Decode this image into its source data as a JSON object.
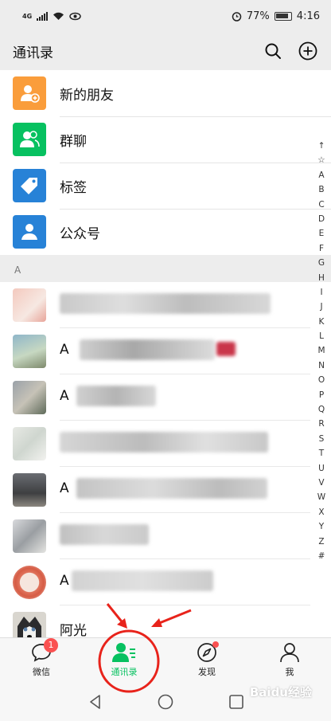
{
  "status_bar": {
    "network": "4G",
    "alarm_icon": "alarm-clock-icon",
    "battery_percent": "77%",
    "time": "4:16"
  },
  "header": {
    "title": "通讯录",
    "search_icon": "search-icon",
    "add_icon": "add-circle-icon"
  },
  "top_entries": [
    {
      "label": "新的朋友",
      "icon": "add-friend-icon",
      "color": "#fa9d3b"
    },
    {
      "label": "群聊",
      "icon": "group-chat-icon",
      "color": "#07c160"
    },
    {
      "label": "标签",
      "icon": "tag-icon",
      "color": "#2782d7"
    },
    {
      "label": "公众号",
      "icon": "official-account-icon",
      "color": "#2782d7"
    }
  ],
  "section": {
    "letter": "A"
  },
  "contacts": [
    {
      "name": ""
    },
    {
      "name": "A"
    },
    {
      "name": "A"
    },
    {
      "name": ""
    },
    {
      "name": "A"
    },
    {
      "name": ""
    },
    {
      "name": "A"
    },
    {
      "name": "阿光"
    }
  ],
  "index_letters": [
    "↑",
    "☆",
    "A",
    "B",
    "C",
    "D",
    "E",
    "F",
    "G",
    "H",
    "I",
    "J",
    "K",
    "L",
    "M",
    "N",
    "O",
    "P",
    "Q",
    "R",
    "S",
    "T",
    "U",
    "V",
    "W",
    "X",
    "Y",
    "Z",
    "#"
  ],
  "tabs": [
    {
      "label": "微信",
      "icon": "chat-bubble-icon",
      "badge": "1"
    },
    {
      "label": "通讯录",
      "icon": "contacts-icon",
      "active": true
    },
    {
      "label": "发现",
      "icon": "compass-icon",
      "dot": true
    },
    {
      "label": "我",
      "icon": "person-icon"
    }
  ],
  "colors": {
    "accent": "#07c160",
    "badge": "#fa5151",
    "annotation": "#e8231b"
  },
  "watermark": "Baidu经验"
}
